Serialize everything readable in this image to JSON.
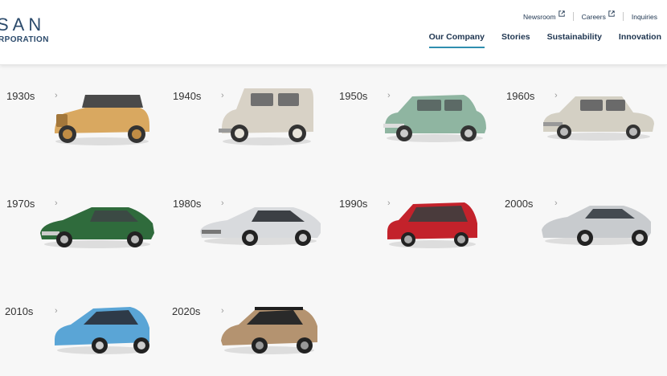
{
  "header": {
    "logo_top": "SAN",
    "logo_bottom": "RPORATION",
    "utility": [
      {
        "label": "Newsroom",
        "external": true
      },
      {
        "label": "Careers",
        "external": true
      },
      {
        "label": "Inquiries",
        "external": false
      }
    ],
    "nav": [
      {
        "label": "Our Company",
        "active": true
      },
      {
        "label": "Stories",
        "active": false
      },
      {
        "label": "Sustainability",
        "active": false
      },
      {
        "label": "Innovation",
        "active": false
      }
    ]
  },
  "colors": {
    "brand": "#2b4a6b",
    "nav_text": "#1e3550",
    "active_underline": "#2f8fb0"
  },
  "decades": [
    {
      "label": "1930s",
      "car_color": "#d9a860",
      "icon": "roadster-icon"
    },
    {
      "label": "1940s",
      "car_color": "#d8d2c6",
      "icon": "compact-car-icon"
    },
    {
      "label": "1950s",
      "car_color": "#8fb5a1",
      "icon": "sedan-icon"
    },
    {
      "label": "1960s",
      "car_color": "#d4d0c4",
      "icon": "sedan-icon"
    },
    {
      "label": "1970s",
      "car_color": "#2f6b3c",
      "icon": "sports-car-icon"
    },
    {
      "label": "1980s",
      "car_color": "#d8dadd",
      "icon": "sports-car-icon"
    },
    {
      "label": "1990s",
      "car_color": "#c3222b",
      "icon": "hatchback-icon"
    },
    {
      "label": "2000s",
      "car_color": "#c8cbce",
      "icon": "sports-car-icon"
    },
    {
      "label": "2010s",
      "car_color": "#5aa5d6",
      "icon": "hatchback-icon"
    },
    {
      "label": "2020s",
      "car_color": "#b49370",
      "icon": "suv-icon"
    }
  ],
  "chevron": "›"
}
